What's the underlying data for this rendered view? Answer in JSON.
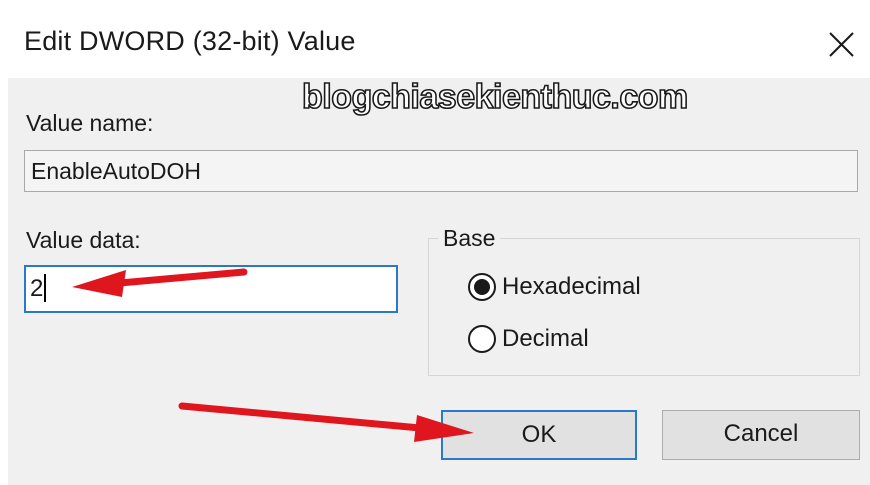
{
  "dialog": {
    "title": "Edit DWORD (32-bit) Value",
    "watermark": "blogchiasekienthuc.com",
    "value_name_label": "Value name:",
    "value_name": "EnableAutoDOH",
    "value_data_label": "Value data:",
    "value_data": "2",
    "base_label": "Base",
    "base_options": [
      {
        "label": "Hexadecimal",
        "selected": true
      },
      {
        "label": "Decimal",
        "selected": false
      }
    ],
    "ok_label": "OK",
    "cancel_label": "Cancel"
  },
  "icons": {
    "close": "close-icon",
    "arrow": "red-arrow-annotation"
  },
  "colors": {
    "focus_border": "#2a78c8",
    "annotation_arrow": "#e0161e",
    "dialog_bg": "#f0f0f0"
  }
}
